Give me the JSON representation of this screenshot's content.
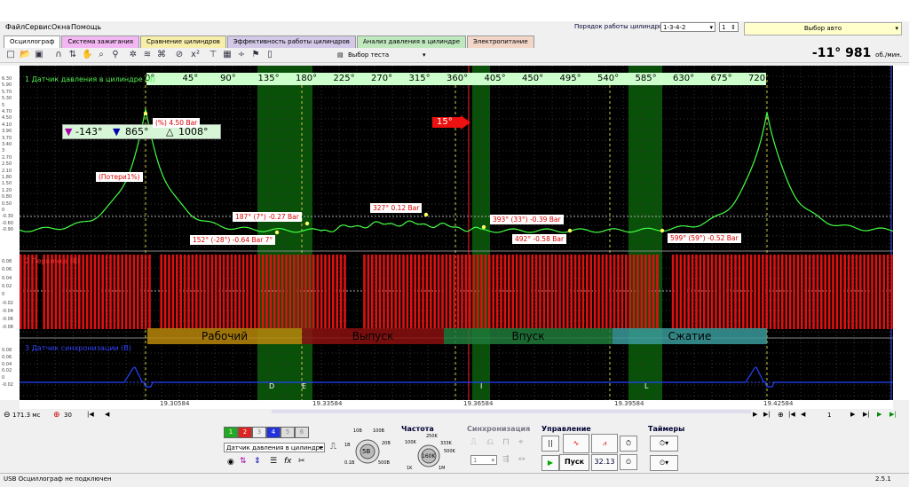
{
  "menu": [
    "Файл",
    "Сервис",
    "Окна",
    "Помощь"
  ],
  "cyl_order": {
    "label": "Порядок работы цилиндров",
    "value": "1-3-4-2",
    "num": "1"
  },
  "car_select": "Выбор авто",
  "tabs": [
    {
      "label": "Осциллограф",
      "color": "#ffffff"
    },
    {
      "label": "Система зажигания",
      "color": "#f2b6f2"
    },
    {
      "label": "Сравнение цилиндров",
      "color": "#f7eeaa"
    },
    {
      "label": "Эффективность работы цилиндров",
      "color": "#d3c8e8"
    },
    {
      "label": "Анализ давления в цилиндре",
      "color": "#bfe8bf"
    },
    {
      "label": "Электропитание",
      "color": "#f2d6c8"
    }
  ],
  "toolbar": {
    "test_select": "Выбор теста"
  },
  "rpm": {
    "value": "-11° 981",
    "unit": "об./мин."
  },
  "degrees": [
    "0°",
    "45°",
    "90°",
    "135°",
    "180°",
    "225°",
    "270°",
    "315°",
    "360°",
    "405°",
    "450°",
    "495°",
    "540°",
    "585°",
    "630°",
    "675°",
    "720°"
  ],
  "channels": {
    "ch1": "1 Датчик давления в цилиндре (В)",
    "ch2": "2 Первичка (В)",
    "ch3": "3 Датчик синхронизации (В)"
  },
  "y_ticks": [
    "6.30",
    "5.90",
    "5.70",
    "5.30",
    "5",
    "4.70",
    "4.50",
    "4.10",
    "3.90",
    "3.70",
    "3.40",
    "3",
    "2.70",
    "2.50",
    "2.10",
    "1.80",
    "1.50",
    "1.20",
    "0.80",
    "0.50",
    "0",
    "-0.30",
    "-0.60",
    "-0.90"
  ],
  "y_ticks2": [
    "0.08",
    "0.06",
    "0.04",
    "0.02",
    "0",
    "-0.02",
    "-0.04",
    "-0.06",
    "-0.08"
  ],
  "y_ticks3": [
    "0.08",
    "0.06",
    "0.04",
    "0.02",
    "0",
    "-0.02"
  ],
  "markers": {
    "m1": "-143°",
    "m2": "865°",
    "delta": "1008°"
  },
  "annotations": {
    "peak": "(%) 4.50 Bar",
    "losses": "(Потери1%)",
    "a1": "187° (7°) -0.27 Bar",
    "a2": "152° (-28°) -0.64 Bar 7°",
    "a3": "327° 0.12 Bar",
    "a4": "393° (33°) -0.39 Bar",
    "a5": "492° -0.58 Bar",
    "a6": "599° (59°) -0.52 Bar"
  },
  "timing_arrow": "15°",
  "phases": [
    {
      "label": "Рабочий",
      "color": "#b8860b"
    },
    {
      "label": "Выпуск",
      "color": "#8b1010"
    },
    {
      "label": "Впуск",
      "color": "#1f7a3a"
    },
    {
      "label": "Сжатие",
      "color": "#3a9a9a"
    }
  ],
  "bottom_marks": [
    "D",
    "E",
    "I",
    "L"
  ],
  "timeline": [
    "19.30584",
    "19.33584",
    "19.36584",
    "19.39584",
    "19.42584"
  ],
  "scale": {
    "time": "171.3 мс",
    "zoom": "30"
  },
  "page": "1",
  "controls": {
    "channel_buttons": [
      "1",
      "2",
      "3",
      "4",
      "5",
      "6"
    ],
    "sensor": "Датчик давления в цилиндре",
    "frequency_title": "Частота",
    "sync_title": "Синхронизация",
    "control_title": "Управление",
    "timers_title": "Таймеры",
    "volts": "5В",
    "volt_scale": [
      "10В",
      "100В",
      "20В",
      "1В",
      "0.1В",
      "500В"
    ],
    "freq": "160K",
    "freq_scale": [
      "100K",
      "250K",
      "333K",
      "500K",
      "1K",
      "1M"
    ],
    "start": "Пуск",
    "value": "32.13",
    "sync_value": "1"
  },
  "status": {
    "left": "USB Осциллограф не подключен",
    "version": "2.5.1"
  },
  "colors": {
    "trace": "#44ff44",
    "primary": "#dd1111",
    "sync": "#2244ff",
    "grid": "#333333",
    "cursor_bg": "#0a5a0a"
  }
}
